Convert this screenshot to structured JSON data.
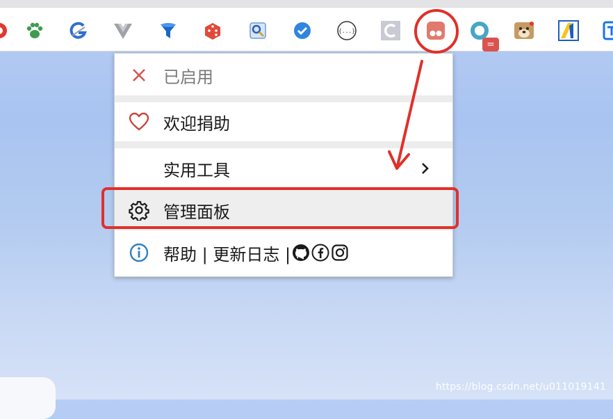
{
  "toolbar": {
    "extensions": [
      {
        "icon": "red-extension-icon-partial"
      },
      {
        "icon": "paw-icon"
      },
      {
        "icon": "g-translate-icon"
      },
      {
        "icon": "vue-devtools-icon"
      },
      {
        "icon": "funnel-icon"
      },
      {
        "icon": "dice-icon"
      },
      {
        "icon": "magnifier-icon"
      },
      {
        "icon": "check-badge-icon"
      },
      {
        "icon": "json-viewer-icon"
      },
      {
        "icon": "c-letter-icon"
      },
      {
        "icon": "tampermonkey-icon"
      },
      {
        "icon": "ring-icon",
        "badge": "="
      },
      {
        "icon": "doge-icon"
      },
      {
        "icon": "number-one-icon"
      },
      {
        "icon": "translate-partial-icon"
      }
    ]
  },
  "menu": {
    "enabled_label": "已启用",
    "donate_label": "欢迎捐助",
    "tools_label": "实用工具",
    "panel_label": "管理面板",
    "help_label": "帮助 | 更新日志 |"
  },
  "colors": {
    "highlight_red": "#e0302a",
    "close_x": "#d9534f",
    "tampermonkey_bg": "#e07a6d",
    "info_blue": "#2f7fc1"
  },
  "watermark": "https://blog.csdn.net/u011019141"
}
